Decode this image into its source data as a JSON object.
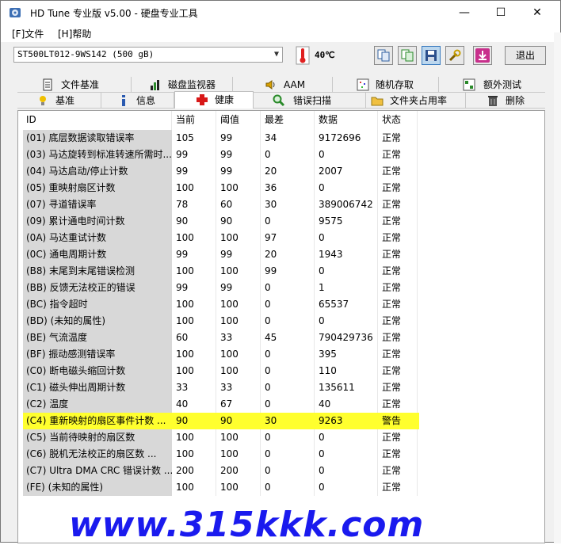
{
  "window": {
    "title": "HD Tune 专业版 v5.00 - 硬盘专业工具"
  },
  "window_controls": {
    "minimize": "—",
    "maximize": "☐",
    "close": "✕"
  },
  "menu": {
    "file": "[F]文件",
    "help": "[H]帮助"
  },
  "toolbar": {
    "drive": "ST500LT012-9WS142 (500 gB)",
    "temperature": "40℃",
    "exit_label": "退出"
  },
  "tabs_row1": [
    {
      "label": "文件基准",
      "icon": "file-benchmark-icon"
    },
    {
      "label": "磁盘监视器",
      "icon": "disk-monitor-icon"
    },
    {
      "label": "AAM",
      "icon": "speaker-icon"
    },
    {
      "label": "随机存取",
      "icon": "random-access-icon"
    },
    {
      "label": "额外测试",
      "icon": "extra-tests-icon"
    }
  ],
  "tabs_row2": [
    {
      "label": "基准",
      "icon": "benchmark-icon"
    },
    {
      "label": "信息",
      "icon": "info-icon"
    },
    {
      "label": "健康",
      "icon": "health-cross-icon"
    },
    {
      "label": "错误扫描",
      "icon": "error-scan-icon"
    },
    {
      "label": "文件夹占用率",
      "icon": "folder-usage-icon"
    },
    {
      "label": "删除",
      "icon": "trash-icon"
    }
  ],
  "table": {
    "headers": {
      "id": "ID",
      "current": "当前",
      "threshold": "阈值",
      "worst": "最差",
      "data": "数据",
      "status": "状态"
    },
    "rows": [
      {
        "id": "(01) 底层数据读取错误率",
        "current": "105",
        "threshold": "99",
        "worst": "34",
        "data": "9172696",
        "status": "正常"
      },
      {
        "id": "(03) 马达旋转到标准转速所需时...",
        "current": "99",
        "threshold": "99",
        "worst": "0",
        "data": "0",
        "status": "正常"
      },
      {
        "id": "(04) 马达启动/停止计数",
        "current": "99",
        "threshold": "99",
        "worst": "20",
        "data": "2007",
        "status": "正常"
      },
      {
        "id": "(05) 重映射扇区计数",
        "current": "100",
        "threshold": "100",
        "worst": "36",
        "data": "0",
        "status": "正常"
      },
      {
        "id": "(07) 寻道错误率",
        "current": "78",
        "threshold": "60",
        "worst": "30",
        "data": "389006742",
        "status": "正常"
      },
      {
        "id": "(09) 累计通电时间计数",
        "current": "90",
        "threshold": "90",
        "worst": "0",
        "data": "9575",
        "status": "正常"
      },
      {
        "id": "(0A) 马达重试计数",
        "current": "100",
        "threshold": "100",
        "worst": "97",
        "data": "0",
        "status": "正常"
      },
      {
        "id": "(0C) 通电周期计数",
        "current": "99",
        "threshold": "99",
        "worst": "20",
        "data": "1943",
        "status": "正常"
      },
      {
        "id": "(B8) 末尾到末尾错误检测",
        "current": "100",
        "threshold": "100",
        "worst": "99",
        "data": "0",
        "status": "正常"
      },
      {
        "id": "(BB) 反馈无法校正的错误",
        "current": "99",
        "threshold": "99",
        "worst": "0",
        "data": "1",
        "status": "正常"
      },
      {
        "id": "(BC) 指令超时",
        "current": "100",
        "threshold": "100",
        "worst": "0",
        "data": "65537",
        "status": "正常"
      },
      {
        "id": "(BD) (未知的属性)",
        "current": "100",
        "threshold": "100",
        "worst": "0",
        "data": "0",
        "status": "正常"
      },
      {
        "id": "(BE) 气流温度",
        "current": "60",
        "threshold": "33",
        "worst": "45",
        "data": "790429736",
        "status": "正常"
      },
      {
        "id": "(BF) 振动感测错误率",
        "current": "100",
        "threshold": "100",
        "worst": "0",
        "data": "395",
        "status": "正常"
      },
      {
        "id": "(C0) 断电磁头缩回计数",
        "current": "100",
        "threshold": "100",
        "worst": "0",
        "data": "110",
        "status": "正常"
      },
      {
        "id": "(C1) 磁头伸出周期计数",
        "current": "33",
        "threshold": "33",
        "worst": "0",
        "data": "135611",
        "status": "正常"
      },
      {
        "id": "(C2) 温度",
        "current": "40",
        "threshold": "67",
        "worst": "0",
        "data": "40",
        "status": "正常"
      },
      {
        "id": "(C4) 重新映射的扇区事件计数   ...",
        "current": "90",
        "threshold": "90",
        "worst": "30",
        "data": "9263",
        "status": "警告",
        "warn": true
      },
      {
        "id": "(C5) 当前待映射的扇区数",
        "current": "100",
        "threshold": "100",
        "worst": "0",
        "data": "0",
        "status": "正常"
      },
      {
        "id": "(C6) 脱机无法校正的扇区数      ...",
        "current": "100",
        "threshold": "100",
        "worst": "0",
        "data": "0",
        "status": "正常"
      },
      {
        "id": "(C7) Ultra DMA CRC 错误计数 ...",
        "current": "200",
        "threshold": "200",
        "worst": "0",
        "data": "0",
        "status": "正常"
      },
      {
        "id": "(FE) (未知的属性)",
        "current": "100",
        "threshold": "100",
        "worst": "0",
        "data": "0",
        "status": "正常"
      }
    ]
  },
  "watermark": {
    "text": "www.315kkk.com"
  },
  "colors": {
    "warn_row": "#ffff2e",
    "watermark": "#1a1aee",
    "id_column_bg": "#d8d8d8"
  }
}
